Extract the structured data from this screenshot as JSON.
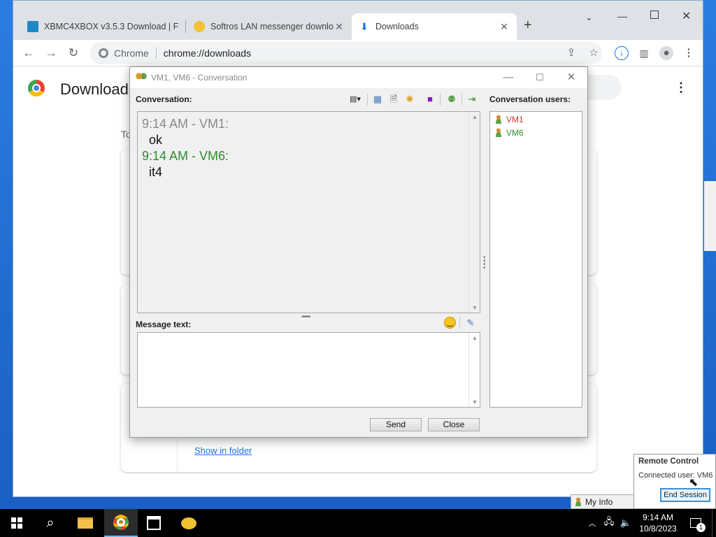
{
  "browser": {
    "tabs": [
      {
        "title": "XBMC4XBOX v3.5.3 Download | F",
        "icon": "gear-app-icon"
      },
      {
        "title": "Softros LAN messenger downloa",
        "icon": "speech-bubble-icon"
      },
      {
        "title": "Downloads",
        "icon": "download-icon"
      }
    ],
    "omnibox": {
      "chip": "Chrome",
      "url": "chrome://downloads"
    },
    "page": {
      "title": "Downloads",
      "date_group": "To",
      "show_in_folder": "Show in folder"
    }
  },
  "conversation": {
    "window_title": "VM1, VM6 - Conversation",
    "conversation_label": "Conversation:",
    "users_label": "Conversation users:",
    "message_label": "Message text:",
    "messages": [
      {
        "header": "9:14 AM - VM1:",
        "text": "ok",
        "color": "#8a8a8a"
      },
      {
        "header": "9:14 AM - VM6:",
        "text": "it4",
        "color": "#2e8b2e"
      }
    ],
    "users": [
      {
        "name": "VM1",
        "color": "#c0392b"
      },
      {
        "name": "VM6",
        "color": "#2e8b2e"
      }
    ],
    "send_button": "Send",
    "close_button": "Close"
  },
  "remote_control": {
    "title": "Remote Control",
    "status": "Connected user: VM6",
    "end_button": "End Session",
    "my_info": "My Info"
  },
  "taskbar": {
    "clock_time": "9:14 AM",
    "clock_date": "10/8/2023",
    "notification_count": "1"
  }
}
